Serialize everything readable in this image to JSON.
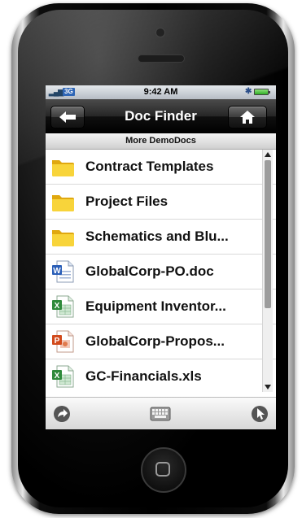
{
  "status": {
    "carrier": "3G",
    "time": "9:42 AM"
  },
  "nav": {
    "title": "Doc Finder"
  },
  "subheader": "More DemoDocs",
  "items": [
    {
      "label": "Contract Templates",
      "icon": "folder-icon"
    },
    {
      "label": "Project Files",
      "icon": "folder-icon"
    },
    {
      "label": "Schematics and Blu...",
      "icon": "folder-icon"
    },
    {
      "label": "GlobalCorp-PO.doc",
      "icon": "word-doc-icon"
    },
    {
      "label": "Equipment Inventor...",
      "icon": "excel-doc-icon"
    },
    {
      "label": "GlobalCorp-Propos...",
      "icon": "powerpoint-doc-icon"
    },
    {
      "label": "GC-Financials.xls",
      "icon": "excel-doc-icon"
    }
  ],
  "colors": {
    "folder": "#f3c623",
    "word": "#2b5fb8",
    "excel": "#2f8a3b",
    "powerpoint": "#d24a1c"
  }
}
